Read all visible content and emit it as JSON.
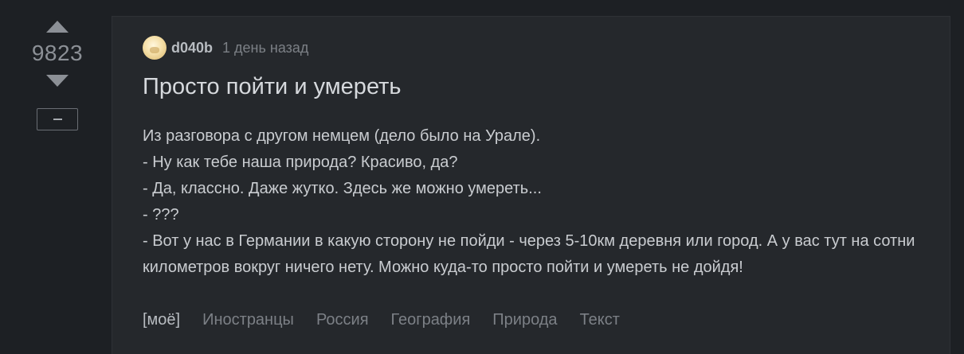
{
  "votes": {
    "count": "9823"
  },
  "story": {
    "author": "d040b",
    "time": "1 день назад",
    "title": "Просто пойти и умереть",
    "lines": [
      "Из разговора с другом немцем (дело было на Урале).",
      "- Ну как тебе наша природа? Красиво, да?",
      "- Да, классно. Даже жутко. Здесь же можно умереть...",
      "- ???",
      "- Вот у нас в Германии в какую сторону не пойди - через 5-10км деревня или город. А у вас тут на сотни километров вокруг ничего нету. Можно куда-то просто пойти и умереть не дойдя!"
    ],
    "tags": [
      "[моё]",
      "Иностранцы",
      "Россия",
      "География",
      "Природа",
      "Текст"
    ]
  }
}
